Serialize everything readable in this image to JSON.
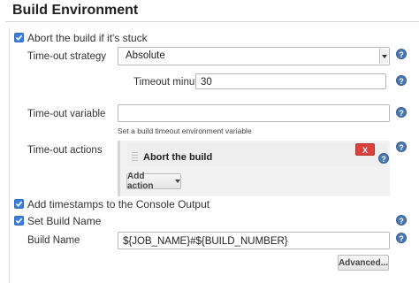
{
  "section": {
    "title": "Build Environment"
  },
  "abort_stuck": {
    "label": "Abort the build if it's stuck",
    "checked": true
  },
  "timeout_strategy": {
    "label": "Time-out strategy",
    "selected": "Absolute"
  },
  "timeout_minutes": {
    "label": "Timeout minutes",
    "value": "30"
  },
  "timeout_variable": {
    "label": "Time-out variable",
    "value": "",
    "hint": "Set a build timeout environment variable"
  },
  "timeout_actions": {
    "label": "Time-out actions",
    "items": [
      {
        "title": "Abort the build",
        "delete_label": "X"
      }
    ],
    "add_label": "Add action"
  },
  "timestamps": {
    "label": "Add timestamps to the Console Output",
    "checked": true
  },
  "set_build_name": {
    "label": "Set Build Name",
    "checked": true
  },
  "build_name": {
    "label": "Build Name",
    "value": "${JOB_NAME}#${BUILD_NUMBER}"
  },
  "advanced_label": "Advanced...",
  "help_glyph": "?",
  "colors": {
    "accent": "#3f7ed6",
    "help": "#4a78b0",
    "danger": "#d9413d"
  }
}
